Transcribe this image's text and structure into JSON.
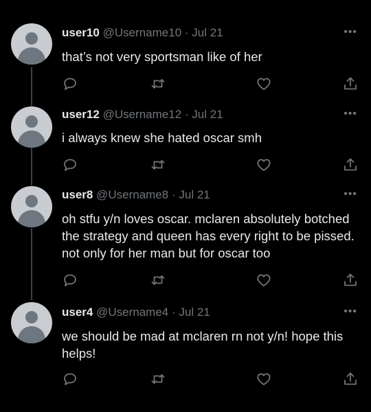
{
  "tweets": [
    {
      "name": "user10",
      "handle": "@Username10",
      "dot": "·",
      "date": "Jul 21",
      "text": "that’s not very sportsman like of her"
    },
    {
      "name": "user12",
      "handle": "@Username12",
      "dot": "·",
      "date": "Jul 21",
      "text": "i always knew she hated oscar smh"
    },
    {
      "name": "user8",
      "handle": "@Username8",
      "dot": "·",
      "date": "Jul 21",
      "text": "oh stfu y/n loves oscar. mclaren absolutely botched the strategy and queen has every right to be pissed. not only for her man but for oscar too"
    },
    {
      "name": "user4",
      "handle": "@Username4",
      "dot": "·",
      "date": "Jul 21",
      "text": "we should be mad at mclaren rn not y/n! hope this helps!"
    }
  ],
  "more_glyph": "•••",
  "icons": {
    "reply": "reply-icon",
    "retweet": "retweet-icon",
    "like": "like-icon",
    "share": "share-icon",
    "more": "more-icon",
    "avatar": "default-avatar"
  },
  "colors": {
    "background": "#000000",
    "text": "#e7e9ea",
    "secondary": "#71767b",
    "thread_line": "#3e4144"
  }
}
